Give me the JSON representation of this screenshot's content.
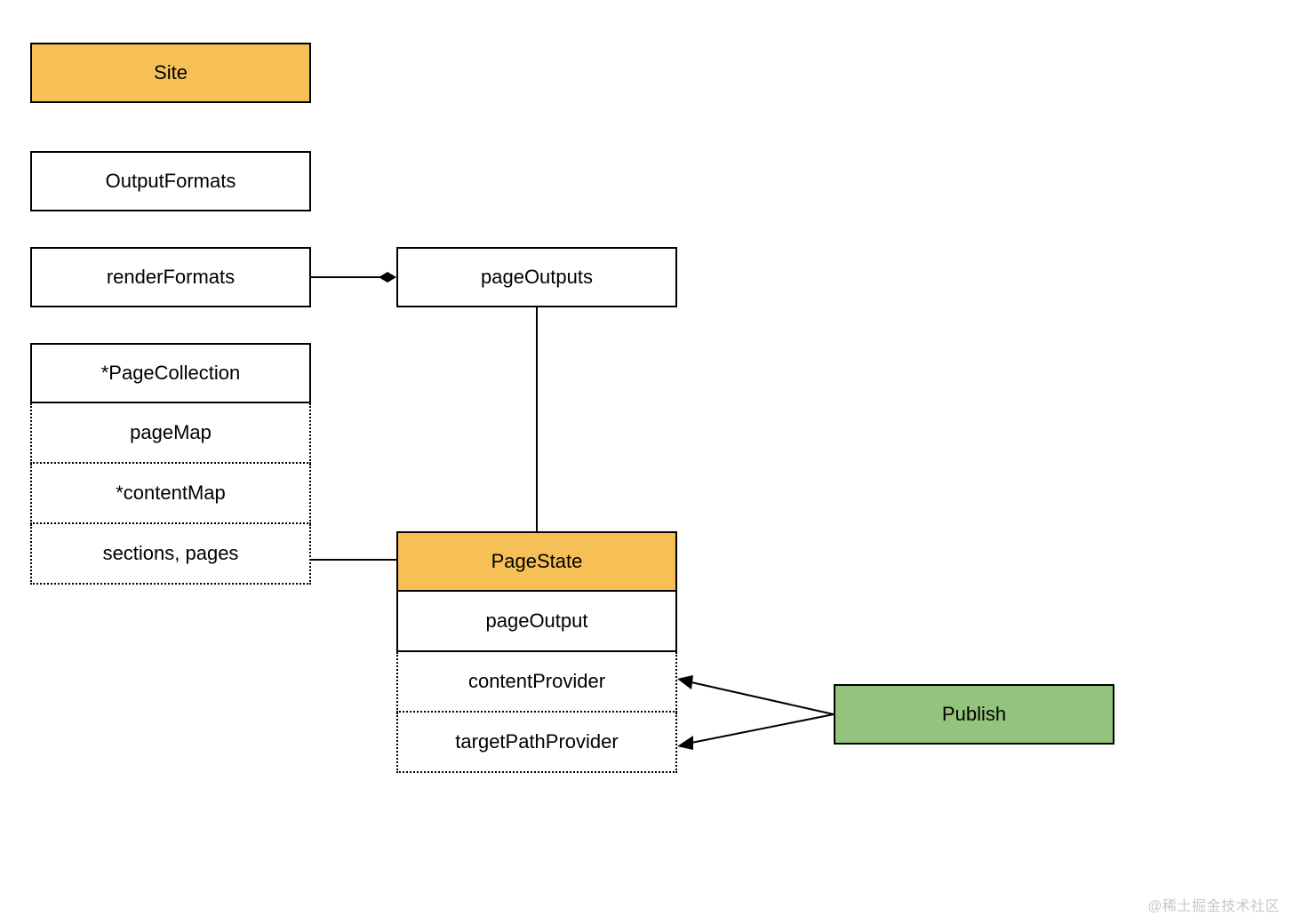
{
  "nodes": {
    "site": "Site",
    "outputFormats": "OutputFormats",
    "renderFormats": "renderFormats",
    "pageOutputs": "pageOutputs",
    "pageCollection": "*PageCollection",
    "pageMap": "pageMap",
    "contentMap": "*contentMap",
    "sectionsPages": "sections, pages",
    "pageState": "PageState",
    "pageOutput": "pageOutput",
    "contentProvider": "contentProvider",
    "targetPathProvider": "targetPathProvider",
    "publish": "Publish"
  },
  "watermark": "@稀土掘金技术社区",
  "colors": {
    "gold": "#f7c057",
    "green": "#93c47d"
  }
}
